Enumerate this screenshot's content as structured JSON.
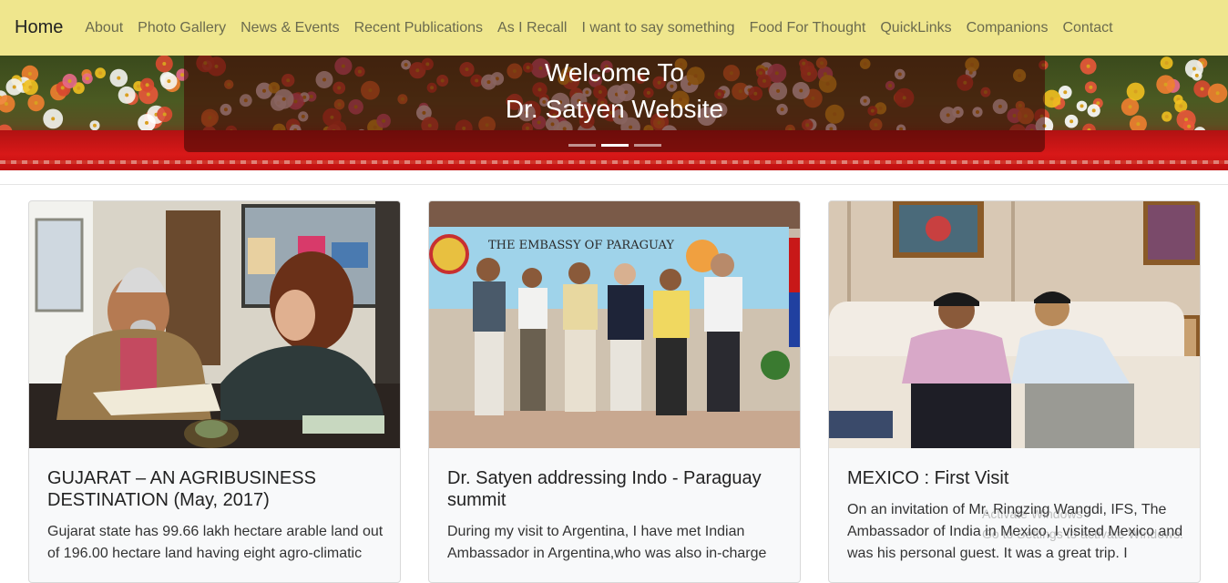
{
  "navbar": {
    "brand": "Home",
    "items": [
      {
        "label": "About"
      },
      {
        "label": "Photo Gallery"
      },
      {
        "label": "News & Events"
      },
      {
        "label": "Recent Publications"
      },
      {
        "label": "As I Recall"
      },
      {
        "label": "I want to say something"
      },
      {
        "label": "Food For Thought"
      },
      {
        "label": "QuickLinks"
      },
      {
        "label": "Companions"
      },
      {
        "label": "Contact"
      }
    ]
  },
  "hero": {
    "line1": "Welcome To",
    "line2": "Dr. Satyen Website",
    "slide_count": 3,
    "active_slide": 2
  },
  "cards": [
    {
      "title": "GUJARAT – AN AGRIBUSINESS DESTINATION (May, 2017)",
      "text": "Gujarat state has 99.66 lakh hectare arable land out of 196.00 hectare land having eight agro-climatic"
    },
    {
      "title": "Dr. Satyen addressing Indo - Paraguay summit",
      "text": "During my visit to Argentina, I have met Indian Ambassador in Argentina,who was also in-charge",
      "banner_text": "THE EMBASSY OF PARAGUAY"
    },
    {
      "title": "MEXICO : First Visit",
      "text": "On an invitation of Mr. Ringzing Wangdi, IFS, The Ambassador of India in Mexico, I visited Mexico and was his personal guest. It was a great trip. I"
    }
  ],
  "watermark": {
    "line1": "Activate Windows",
    "line2": "Go to Settings to activate Windows."
  },
  "colors": {
    "navbar_bg": "#efe68d",
    "nav_text": "#6b6b4e",
    "card_bg": "#f8f9fa"
  }
}
